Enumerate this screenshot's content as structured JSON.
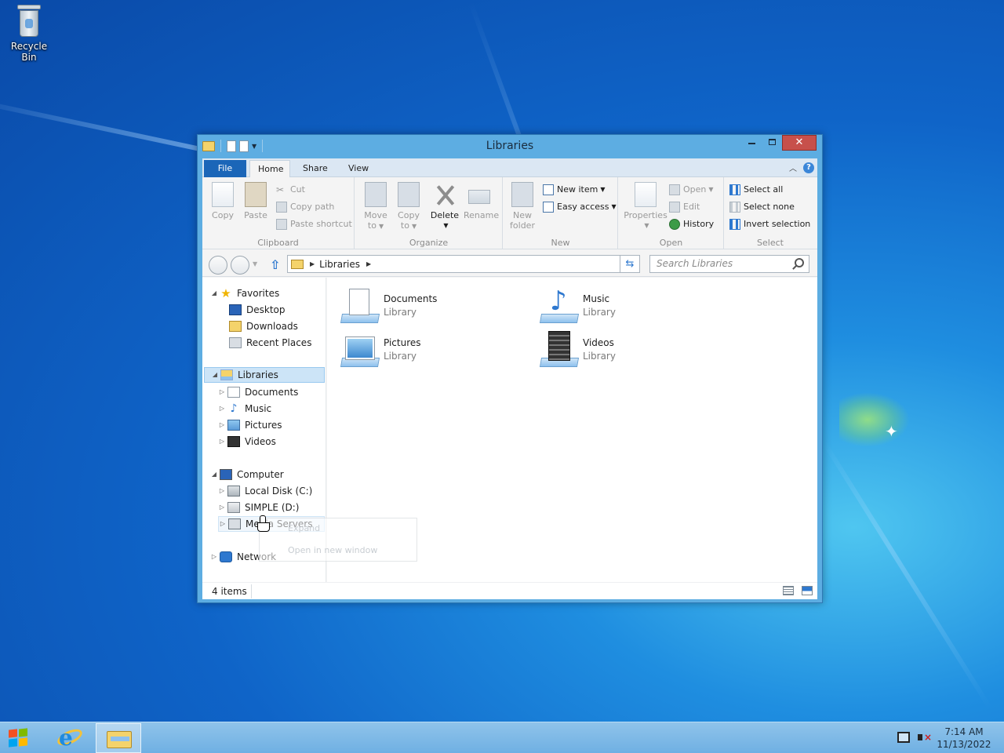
{
  "desktop": {
    "recycle_bin_label": "Recycle Bin"
  },
  "window": {
    "title": "Libraries",
    "close_glyph": "✕"
  },
  "ribbon": {
    "tabs": {
      "file": "File",
      "home": "Home",
      "share": "Share",
      "view": "View"
    },
    "clipboard": {
      "label": "Clipboard",
      "copy": "Copy",
      "paste": "Paste",
      "cut": "Cut",
      "copy_path": "Copy path",
      "paste_shortcut": "Paste shortcut"
    },
    "organize": {
      "label": "Organize",
      "move_to_1": "Move",
      "move_to_2": "to",
      "copy_to_1": "Copy",
      "copy_to_2": "to",
      "delete": "Delete",
      "rename": "Rename"
    },
    "new": {
      "label": "New",
      "new_folder_1": "New",
      "new_folder_2": "folder",
      "new_item": "New item",
      "easy_access": "Easy access"
    },
    "open": {
      "label": "Open",
      "properties": "Properties",
      "open": "Open",
      "edit": "Edit",
      "history": "History"
    },
    "select": {
      "label": "Select",
      "select_all": "Select all",
      "select_none": "Select none",
      "invert_selection": "Invert selection"
    }
  },
  "navbar": {
    "address": "Libraries",
    "search_placeholder": "Search Libraries"
  },
  "tree": {
    "favorites": "Favorites",
    "desktop": "Desktop",
    "downloads": "Downloads",
    "recent_places": "Recent Places",
    "libraries": "Libraries",
    "documents": "Documents",
    "music": "Music",
    "pictures": "Pictures",
    "videos": "Videos",
    "computer": "Computer",
    "local_disk": "Local Disk (C:)",
    "simple": "SIMPLE (D:)",
    "media_servers": "Media Servers",
    "network": "Network"
  },
  "context_menu": {
    "expand": "Expand",
    "open_new_window": "Open in new window"
  },
  "libraries": [
    {
      "name": "Documents",
      "kind": "Library"
    },
    {
      "name": "Music",
      "kind": "Library"
    },
    {
      "name": "Pictures",
      "kind": "Library"
    },
    {
      "name": "Videos",
      "kind": "Library"
    }
  ],
  "status": {
    "items": "4 items"
  },
  "taskbar": {
    "time": "7:14 AM",
    "date": "11/13/2022"
  }
}
